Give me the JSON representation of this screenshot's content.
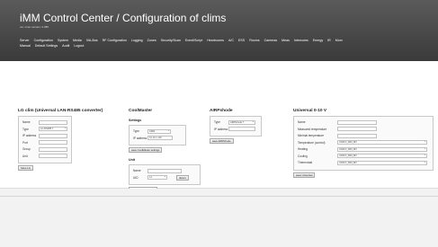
{
  "header": {
    "title": "iMM Control Center / Configuration of clims",
    "version": "ver. inner version: 2.085"
  },
  "nav": {
    "items": [
      "Server",
      "Configuration",
      "System",
      "Media",
      "IVA-Bus",
      "RF Configuration",
      "Logging",
      "Zones",
      "Security/Scan",
      "Event/Script",
      "Heartrooms",
      "A/C",
      "ESS",
      "Rooms",
      "Cameras",
      "Meas",
      "Intercoms",
      "Energy",
      "IR",
      "Mom",
      "Manual",
      "Default Settings",
      "Audit",
      "Logout"
    ]
  },
  "lg": {
    "title": "LG clim (Universal LAN-RS485 converter)",
    "labels": {
      "name": "Name",
      "type": "Type",
      "ip": "IP address",
      "port": "Port",
      "group": "Group",
      "unit": "Unit"
    },
    "values": {
      "type": "LG RS485 T"
    },
    "save": "Save LG"
  },
  "coolmaster": {
    "title": "CoolMaster",
    "settings_title": "Settings",
    "labels": {
      "type": "Type",
      "ip": "IP address"
    },
    "values": {
      "type": "CM4I",
      "ip": "10.10.1.100"
    },
    "save_settings": "save CoolMaster settings",
    "unit_title": "Unit",
    "unit_labels": {
      "name": "Name",
      "uid": "UID"
    },
    "unit_values": {
      "uid": "L1"
    },
    "unit_button": "detect",
    "save_unit": "save CoolMaster unit"
  },
  "airpshode": {
    "title": "AIRPshode",
    "labels": {
      "type": "Type",
      "ip": "IP address"
    },
    "values": {
      "type": "AIRPshode T"
    },
    "save": "save AIRPshode"
  },
  "universal": {
    "title": "Universal 0-10 V",
    "labels": {
      "name": "Name",
      "measured": "Measured temperature",
      "minimal": "Minimal temperature",
      "control": "Temperature (control)",
      "heating": "Heating",
      "cooling": "Cooling",
      "thermostat": "Thermostat"
    },
    "values": {
      "control": "UNICO_DIM_MV",
      "heating": "UNICO_DIM_MV",
      "cooling": "UNICO_DIM_MV",
      "thermostat": "UNICO_DIM_MV"
    },
    "save": "save Universal"
  }
}
